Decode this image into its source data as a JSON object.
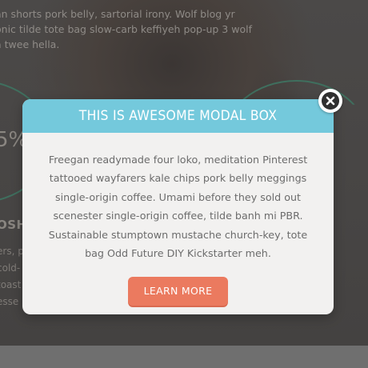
{
  "background": {
    "text_lines": [
      "an shorts pork belly, sartorial irony. Wolf blog yr",
      "onic tilde tote bag slow-carb keffiyeh pop-up 3 wolf",
      "a twee hella."
    ],
    "percent": "5%",
    "heading": "OSH",
    "lower_lines": [
      "ers, p",
      "cold-",
      "toast",
      "esse"
    ]
  },
  "modal": {
    "title": "THIS IS AWESOME MODAL BOX",
    "body_lines": [
      "Freegan readymade four loko, meditation Pinterest",
      "tattooed wayfarers kale chips pork belly meggings",
      "single-origin coffee. Umami before they sold out",
      "scenester single-origin coffee, tilde banh mi PBR.",
      "Sustainable stumptown mustache church-key, tote",
      "bag Odd Future DIY Kickstarter meh."
    ],
    "button_label": "LEARN MORE"
  },
  "colors": {
    "header": "#74c9dc",
    "button": "#eb7a5f",
    "modal_bg": "#f2f1f0",
    "overlay": "#4a4847"
  },
  "icons": {
    "close": "close-icon"
  }
}
